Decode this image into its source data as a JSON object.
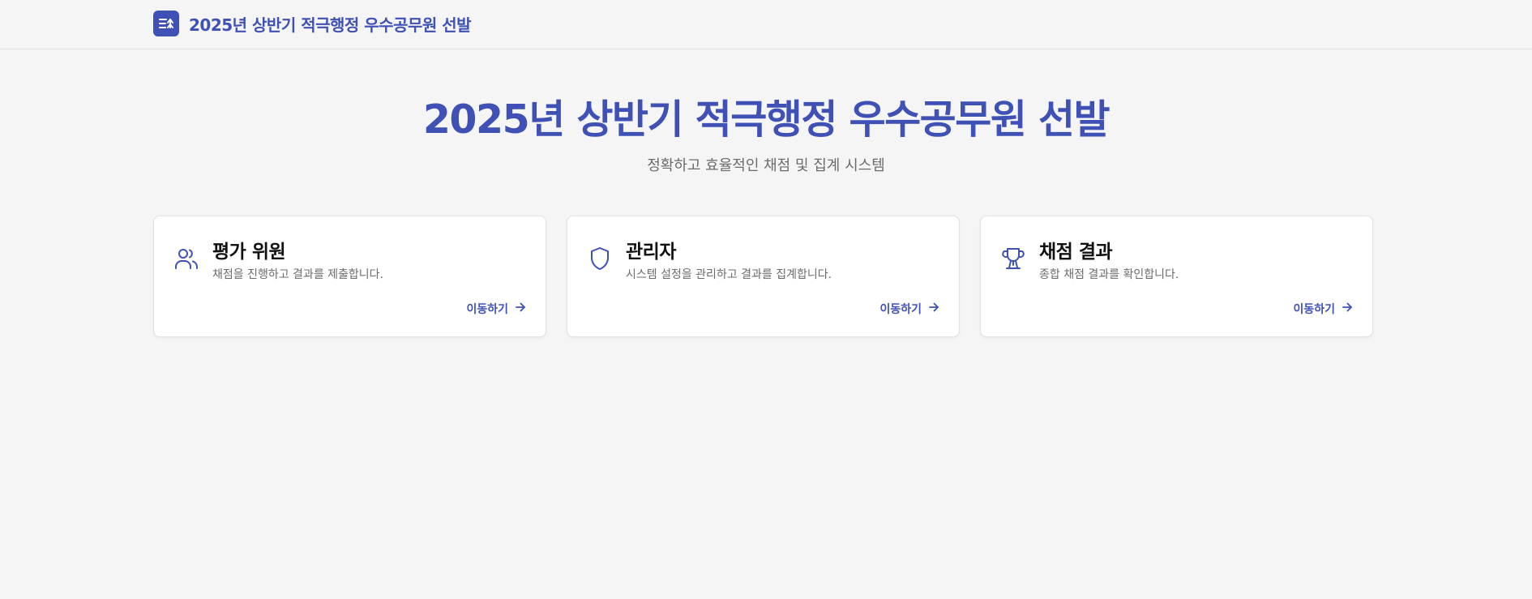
{
  "colors": {
    "accent": "#3f51b5",
    "background": "#f5f5f5",
    "muted_text": "#6b6b6b"
  },
  "header": {
    "logo_icon": "list-arrow-icon",
    "title": "2025년 상반기 적극행정 우수공무원 선발"
  },
  "hero": {
    "title": "2025년 상반기 적극행정 우수공무원 선발",
    "subtitle": "정확하고 효율적인 채점 및 집계 시스템"
  },
  "cards": [
    {
      "icon": "users-icon",
      "title": "평가 위원",
      "description": "채점을 진행하고 결과를 제출합니다.",
      "link_label": "이동하기"
    },
    {
      "icon": "shield-icon",
      "title": "관리자",
      "description": "시스템 설정을 관리하고 결과를 집계합니다.",
      "link_label": "이동하기"
    },
    {
      "icon": "trophy-icon",
      "title": "채점 결과",
      "description": "종합 채점 결과를 확인합니다.",
      "link_label": "이동하기"
    }
  ]
}
